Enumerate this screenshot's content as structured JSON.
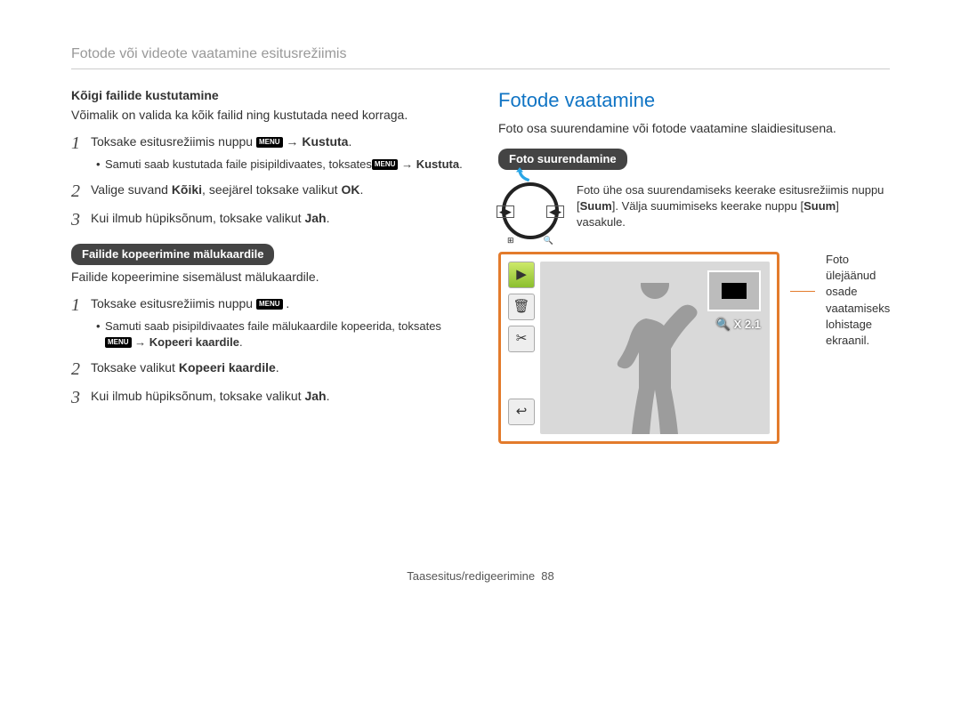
{
  "header": "Fotode või videote vaatamine esitusrežiimis",
  "left": {
    "delete_all_heading": "Kõigi failide kustutamine",
    "delete_all_para": "Võimalik on valida ka kõik failid ning kustutada need korraga.",
    "s1_pre": "Toksake esitusrežiimis nuppu ",
    "s1_arrow": " → ",
    "s1_bold": "Kustuta",
    "s1_dot": ".",
    "s1_sub_pre": "Samuti saab kustutada faile pisipildivaates, toksates",
    "s1_sub_arrow": " → ",
    "s1_sub_bold": "Kustuta",
    "s1_sub_dot": ".",
    "s2_pre": "Valige suvand ",
    "s2_bold1": "Kõiki",
    "s2_mid": ", seejärel toksake valikut ",
    "s2_ok": "OK",
    "s2_dot": ".",
    "s3_pre": "Kui ilmub hüpiksõnum, toksake valikut ",
    "s3_bold": "Jah",
    "s3_dot": ".",
    "copy_pill": "Failide kopeerimine mälukaardile",
    "copy_para": "Failide kopeerimine sisemälust mälukaardile.",
    "c1_pre": "Toksake esitusrežiimis nuppu ",
    "c1_dot": " .",
    "c1_sub_pre": "Samuti saab pisipildivaates faile mälukaardile kopeerida, toksates ",
    "c1_sub_arrow": " → ",
    "c1_sub_bold": "Kopeeri kaardile",
    "c1_sub_dot": ".",
    "c2_pre": "Toksake valikut ",
    "c2_bold": "Kopeeri kaardile",
    "c2_dot": ".",
    "c3_pre": "Kui ilmub hüpiksõnum, toksake valikut ",
    "c3_bold": "Jah",
    "c3_dot": "."
  },
  "right": {
    "heading": "Fotode vaatamine",
    "intro": "Foto osa suurendamine või fotode vaatamine slaidiesitusena.",
    "zoom_pill": "Foto suurendamine",
    "dial_text_pre": "Foto ühe osa suurendamiseks keerake esitusrežiimis nuppu [",
    "dial_text_b1": "Suum",
    "dial_text_mid": "]. Välja suumimiseks keerake nuppu [",
    "dial_text_b2": "Suum",
    "dial_text_post": "] vasakule.",
    "zoom_label_icon": "🔍",
    "zoom_label": "X 2.1",
    "callout": "Foto ülejäänud osade vaatamiseks lohistage ekraanil.",
    "icons": {
      "play": "▶",
      "trash": "🗑",
      "cut": "✂",
      "back": "↩"
    },
    "menu_glyph": "MENU",
    "nav_glyph": "◀▶"
  },
  "footer": {
    "text": "Taasesitus/redigeerimine",
    "page": "88"
  }
}
